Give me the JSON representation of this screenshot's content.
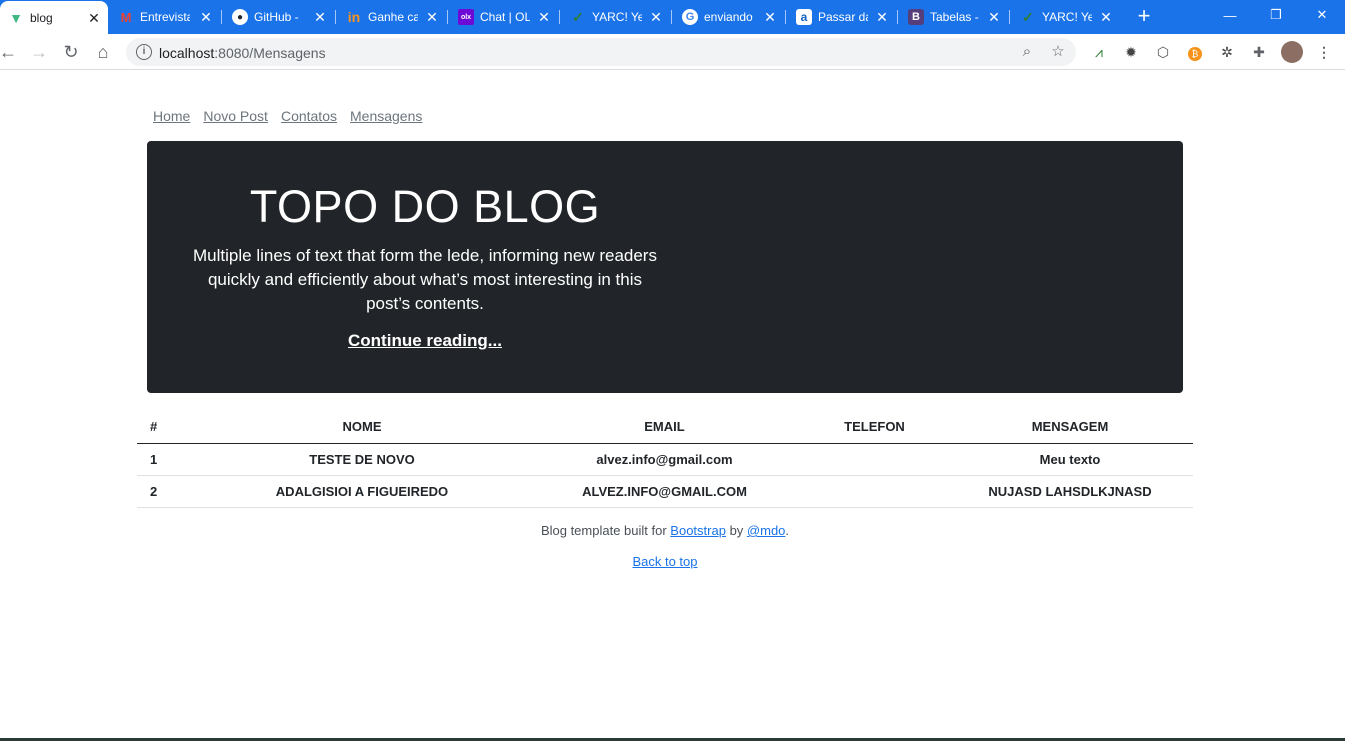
{
  "browser": {
    "tabs": [
      {
        "title": "blog",
        "icon": "vue-icon",
        "color": "#41b883",
        "active": true
      },
      {
        "title": "Entrevista",
        "icon": "gmail-icon",
        "color": "#ea4335"
      },
      {
        "title": "GitHub -",
        "icon": "github-icon",
        "color": "#24292e"
      },
      {
        "title": "Ganhe ca",
        "icon": "indeed-icon",
        "color": "#f7931e"
      },
      {
        "title": "Chat | OL",
        "icon": "olx-icon",
        "color": "#6e0ad6"
      },
      {
        "title": "YARC! Ye",
        "icon": "yarc-icon",
        "color": "#2e7d32"
      },
      {
        "title": "enviando",
        "icon": "google-icon",
        "color": "#4285f4"
      },
      {
        "title": "Passar da",
        "icon": "a-icon",
        "color": "#1565c0"
      },
      {
        "title": "Tabelas -",
        "icon": "bootstrap-icon",
        "color": "#563d7c"
      },
      {
        "title": "YARC! Ye",
        "icon": "yarc-icon",
        "color": "#2e7d32"
      }
    ],
    "address": {
      "host": "localhost",
      "path": ":8080/Mensagens"
    }
  },
  "nav": {
    "items": [
      "Home",
      "Novo Post",
      "Contatos",
      "Mensagens"
    ]
  },
  "hero": {
    "title": "TOPO DO BLOG",
    "lede": "Multiple lines of text that form the lede, informing new readers quickly and efficiently about what’s most interesting in this post’s contents.",
    "link": "Continue reading..."
  },
  "table": {
    "headers": [
      "#",
      "NOME",
      "EMAIL",
      "TELEFON",
      "MENSAGEM"
    ],
    "rows": [
      [
        "1",
        "TESTE DE NOVO",
        "alvez.info@gmail.com",
        "",
        "Meu texto"
      ],
      [
        "2",
        "ADALGISIOI A FIGUEIREDO",
        "ALVEZ.INFO@GMAIL.COM",
        "",
        "NUJASD LAHSDLKJNASD"
      ]
    ]
  },
  "footer": {
    "prefix": "Blog template built for ",
    "bootstrap": "Bootstrap",
    "by": " by ",
    "author": "@mdo",
    "suffix": ".",
    "back_to_top": "Back to top"
  }
}
